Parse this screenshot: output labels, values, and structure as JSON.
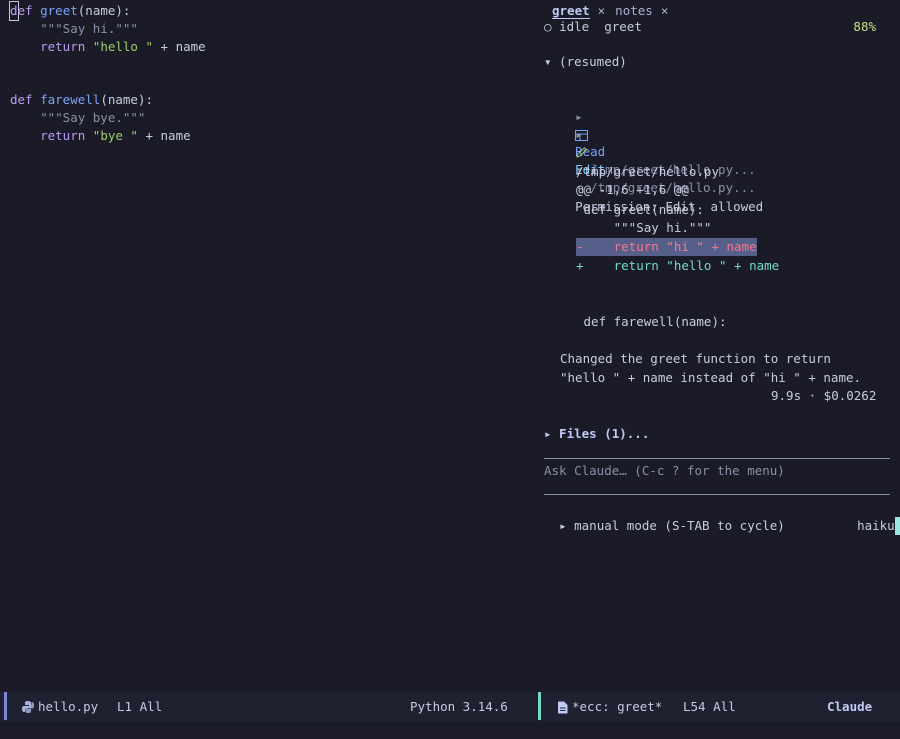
{
  "editor": {
    "lines": [
      {
        "segments": [
          {
            "t": "def",
            "c": "kw",
            "cursor": true
          },
          {
            "t": " ",
            "c": "plain"
          },
          {
            "t": "greet",
            "c": "fn"
          },
          {
            "t": "(name):",
            "c": "plain"
          }
        ]
      },
      {
        "segments": [
          {
            "t": "    \"\"\"Say hi.\"\"\"",
            "c": "doc"
          }
        ]
      },
      {
        "segments": [
          {
            "t": "    return ",
            "c": "kw"
          },
          {
            "t": "\"hello \"",
            "c": "str"
          },
          {
            "t": " + name",
            "c": "plain"
          }
        ]
      },
      {
        "segments": []
      },
      {
        "segments": []
      },
      {
        "segments": [
          {
            "t": "def",
            "c": "kw"
          },
          {
            "t": " ",
            "c": "plain"
          },
          {
            "t": "farewell",
            "c": "fn"
          },
          {
            "t": "(name):",
            "c": "plain"
          }
        ]
      },
      {
        "segments": [
          {
            "t": "    \"\"\"Say bye.\"\"\"",
            "c": "doc"
          }
        ]
      },
      {
        "segments": [
          {
            "t": "    return ",
            "c": "kw"
          },
          {
            "t": "\"bye \"",
            "c": "str"
          },
          {
            "t": " + name",
            "c": "plain"
          }
        ]
      }
    ]
  },
  "claude": {
    "tabs": [
      {
        "label": "greet",
        "close": "×",
        "active": true
      },
      {
        "label": "notes",
        "close": "×",
        "active": false
      }
    ],
    "status": {
      "indicator": "○",
      "state": "idle",
      "session": "greet",
      "percent": "88%"
    },
    "resumed": "▾ (resumed)",
    "tools": [
      {
        "arrow": "▸",
        "name": "Read",
        "icon": "table-icon",
        "path": "· /tmp/greet/hello.py..."
      },
      {
        "arrow": "▸",
        "name": "Edit",
        "icon": "pencil-icon",
        "path": "· /tmp/greet/hello.py..."
      }
    ],
    "permission": {
      "check": "✓",
      "title": "Permission: Edit  allowed",
      "file": "/tmp/greet/hello.py",
      "hunk": "@@ -1,6 +1,6 @@",
      "ctx1": " def greet(name):",
      "ctx2": "     \"\"\"Say hi.\"\"\"",
      "removed": "-    return \"hi \" + name",
      "added": "+    return \"hello \" + name",
      "ctx3": " def farewell(name):"
    },
    "response": [
      "Changed the greet function to return",
      "\"hello \" + name instead of \"hi \" + name."
    ],
    "meta": "9.9s · $0.0262",
    "files": "▸ Files (1)...",
    "prompt": "Ask Claude… (C-c ? for the menu)",
    "mode": "▸ manual mode (S-TAB to cycle)",
    "model": "haiku"
  },
  "modeline_left": {
    "file_icon": "python-icon",
    "filename": "hello.py",
    "position": "L1 All",
    "mode": "Python 3.14.6"
  },
  "modeline_right": {
    "file_icon": "document-icon",
    "buffer": "*ecc: greet*",
    "position": "L54 All",
    "mode": "Claude"
  }
}
